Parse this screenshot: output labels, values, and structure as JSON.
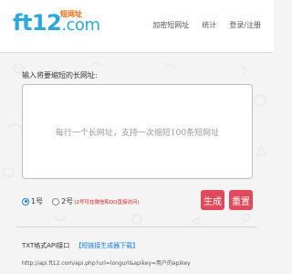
{
  "header": {
    "logo_text": "ft12",
    "logo_domain": ".com",
    "logo_badge": "短网址",
    "nav": [
      "加密短网址",
      "统计",
      "登录/注册"
    ]
  },
  "form": {
    "prompt": "输入将要缩短的长网址:",
    "placeholder": "每行一个长网址，支持一次缩短100条短网址",
    "radio_1": "1号",
    "radio_2": "2号",
    "radio_2_note": "(2号可在微信和QQ直接访问)",
    "generate_label": "生成",
    "reset_label": "重置"
  },
  "footer": {
    "api_label": "TXT格式API接口",
    "api_link": "【短链接生成器下载】",
    "api_url": "http://api.ft12.com/api.php?url=longurl&apikey=用户的apikey"
  },
  "colors": {
    "brand": "#2aa9e0",
    "button": "#e04a5c",
    "link": "#1c7ee6"
  }
}
